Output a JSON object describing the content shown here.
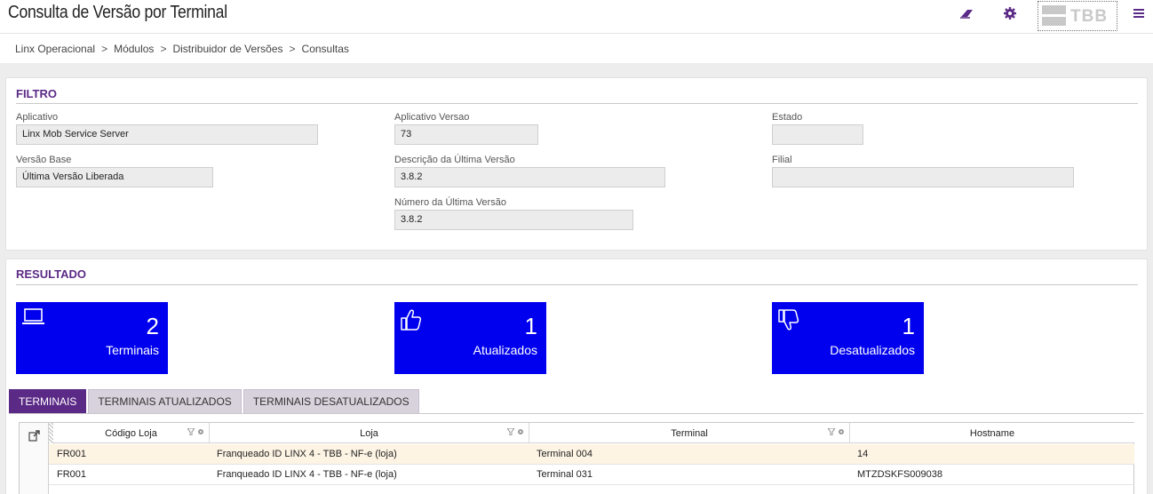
{
  "header": {
    "title": "Consulta de Versão por Terminal",
    "logo_text": "TBB"
  },
  "breadcrumb": [
    "Linx Operacional",
    "Módulos",
    "Distribuidor de Versões",
    "Consultas"
  ],
  "breadcrumb_separator": ">",
  "filtro": {
    "title": "FILTRO",
    "aplicativo": {
      "label": "Aplicativo",
      "value": "Linx Mob Service Server"
    },
    "aplicativo_versao": {
      "label": "Aplicativo Versao",
      "value": "73"
    },
    "estado": {
      "label": "Estado",
      "value": ""
    },
    "versao_base": {
      "label": "Versão Base",
      "value": "Última Versão Liberada"
    },
    "descricao_ultima_versao": {
      "label": "Descrição da Última Versão",
      "value": "3.8.2"
    },
    "filial": {
      "label": "Filial",
      "value": ""
    },
    "numero_ultima_versao": {
      "label": "Número da Última Versão",
      "value": "3.8.2"
    }
  },
  "resultado": {
    "title": "RESULTADO",
    "tiles": [
      {
        "icon": "laptop-icon",
        "count": "2",
        "label": "Terminais"
      },
      {
        "icon": "thumbs-up-icon",
        "count": "1",
        "label": "Atualizados"
      },
      {
        "icon": "thumbs-down-icon",
        "count": "1",
        "label": "Desatualizados"
      }
    ]
  },
  "tabs": [
    {
      "label": "TERMINAIS",
      "active": true
    },
    {
      "label": "TERMINAIS ATUALIZADOS",
      "active": false
    },
    {
      "label": "TERMINAIS DESATUALIZADOS",
      "active": false
    }
  ],
  "grid": {
    "columns": [
      "Código Loja",
      "Loja",
      "Terminal",
      "Hostname"
    ],
    "rows": [
      {
        "codigo_loja": "FR001",
        "loja": "Franqueado ID LINX 4 - TBB - NF-e (loja)",
        "terminal": "Terminal 004",
        "hostname": "14"
      },
      {
        "codigo_loja": "FR001",
        "loja": "Franqueado ID LINX 4 - TBB - NF-e (loja)",
        "terminal": "Terminal 031",
        "hostname": "MTZDSKFS009038"
      }
    ]
  },
  "colors": {
    "accent": "#5b2a86",
    "tile": "#0000ee",
    "selected_row": "#fdf4e4"
  }
}
